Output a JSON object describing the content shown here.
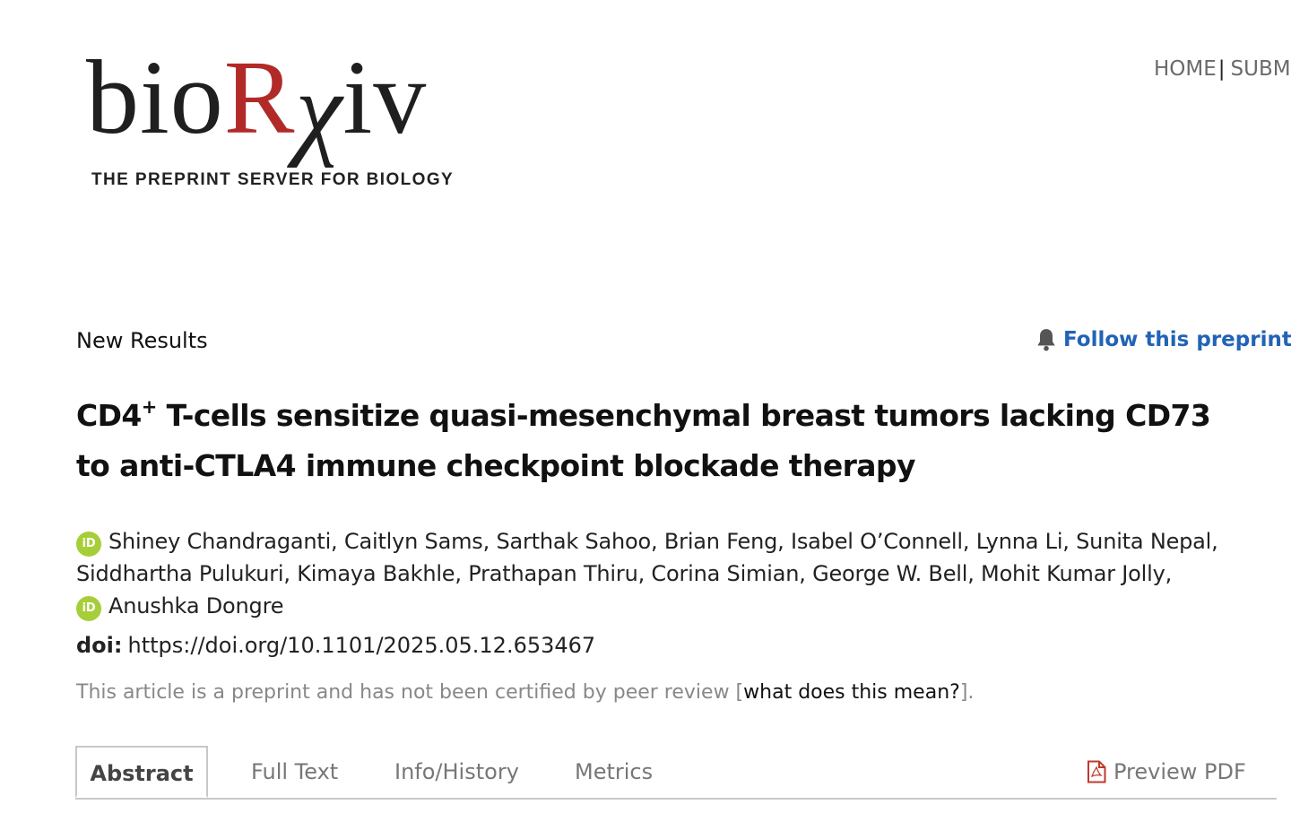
{
  "logo": {
    "word_bio": "bio",
    "word_r": "R",
    "word_chi": "χ",
    "word_iv": "iv",
    "tagline": "THE PREPRINT SERVER FOR BIOLOGY",
    "accent_color": "#b22a28"
  },
  "top_nav": {
    "home": "HOME",
    "separator": "|",
    "submit_partial": "SUBM"
  },
  "article": {
    "type": "New Results",
    "follow_label": "Follow this preprint",
    "follow_icon": "bell-icon",
    "title_prefix": "CD4",
    "title_sup": "+",
    "title_rest": " T-cells sensitize quasi-mesenchymal breast tumors lacking CD73 to anti-CTLA4 immune checkpoint blockade therapy",
    "authors_line1": "Shiney Chandraganti, Caitlyn Sams, Sarthak Sahoo, Brian Feng, Isabel O’Connell, Lynna Li, Sunita Nepal,",
    "authors_line2": "Siddhartha Pulukuri, Kimaya Bakhle, Prathapan Thiru, Corina Simian, George W. Bell, Mohit Kumar Jolly,",
    "authors_line3": "Anushka Dongre",
    "orcid_icon_text": "iD",
    "doi_label": "doi:",
    "doi_url": "https://doi.org/10.1101/2025.05.12.653467",
    "preprint_note_prefix": "This article is a preprint and has not been certified by peer review [",
    "preprint_note_link": "what does this mean?",
    "preprint_note_suffix": "]."
  },
  "tabs": {
    "abstract": "Abstract",
    "full_text": "Full Text",
    "info_history": "Info/History",
    "metrics": "Metrics",
    "preview_pdf": "Preview PDF"
  },
  "colors": {
    "link_blue": "#2263b5",
    "orcid_green": "#a6ce39",
    "pdf_red": "#c0392b"
  }
}
